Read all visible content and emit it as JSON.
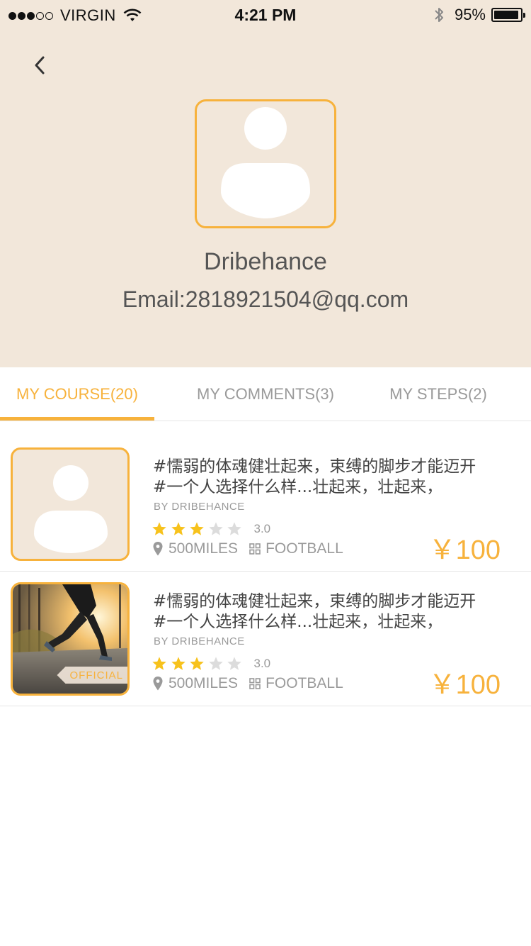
{
  "status_bar": {
    "carrier": "VIRGIN",
    "time": "4:21 PM",
    "battery_text": "95%",
    "battery_level": 0.95,
    "signal_strength": 3,
    "signal_max": 5,
    "icons": [
      "wifi-icon",
      "bluetooth-icon",
      "battery-icon"
    ]
  },
  "header": {
    "back_icon": "chevron-left-icon",
    "avatar_icon": "user-silhouette-icon",
    "name": "Dribehance",
    "email": "Email:2818921504@qq.com"
  },
  "tabs": [
    {
      "label": "MY COURSE(20)",
      "active": true
    },
    {
      "label": "MY COMMENTS(3)",
      "active": false
    },
    {
      "label": "MY STEPS(2)",
      "active": false
    }
  ],
  "courses": [
    {
      "title_line1": "#懦弱的体魂健壮起来，束缚的脚步才能迈开",
      "title_line2": "#一个人选择什么样...壮起来，壮起来，",
      "author": "BY DRIBEHANCE",
      "rating": 3,
      "rating_text": "3.0",
      "distance": "500MILES",
      "category": "FOOTBALL",
      "price": "￥100",
      "thumb": "user-silhouette-icon",
      "tag": ""
    },
    {
      "title_line1": "#懦弱的体魂健壮起来，束缚的脚步才能迈开",
      "title_line2": "#一个人选择什么样...壮起来，壮起来，",
      "author": "BY DRIBEHANCE",
      "rating": 3,
      "rating_text": "3.0",
      "distance": "500MILES",
      "category": "FOOTBALL",
      "price": "￥100",
      "thumb": "runner-photo",
      "tag": "OFFICIAL"
    }
  ],
  "colors": {
    "accent": "#f7b23c",
    "header_bg": "#f2e7da",
    "star_on": "#f7c21c",
    "star_off": "#dcdcdc",
    "text": "#555555",
    "muted": "#9a9a9a"
  }
}
